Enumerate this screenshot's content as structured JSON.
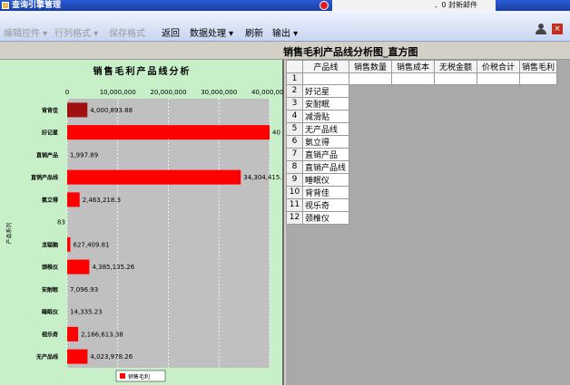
{
  "window": {
    "title": "查询引擎管理",
    "status_text": "．0 封新邮件"
  },
  "toolbar": {
    "items": [
      {
        "label": "编辑控件 ▾",
        "enabled": false
      },
      {
        "label": "行列格式 ▾",
        "enabled": false
      },
      {
        "label": "保存格式",
        "enabled": false
      },
      {
        "label": "返回",
        "enabled": true
      },
      {
        "label": "数据处理 ▾",
        "enabled": true
      },
      {
        "label": "刷新",
        "enabled": true
      },
      {
        "label": "输出 ▾",
        "enabled": true
      }
    ]
  },
  "report": {
    "title": "销售毛利产品线分析图_直方图"
  },
  "chart_data": {
    "type": "bar",
    "orientation": "horizontal",
    "title": "销售毛利产品线分析",
    "ylabel": "产品系列",
    "xlim": [
      0,
      40000000
    ],
    "x_ticks": [
      "0",
      "10,000,000",
      "20,000,000",
      "30,000,000",
      "40,000,000"
    ],
    "categories": [
      "背背佳",
      "好记星",
      "直销产品",
      "直销产品线",
      "氨立得",
      "83",
      "龙聪脑",
      "颈椎仪",
      "安耐眠",
      "睡眠仪",
      "视乐奇",
      "无产品线"
    ],
    "values": [
      4000893.88,
      40000000,
      1997.89,
      34304415,
      2463218.3,
      83,
      627409.81,
      4385135.26,
      7096.93,
      14335.23,
      2166613.38,
      4023978.26
    ],
    "data_labels": [
      "4,000,893.88",
      "40",
      "1,997.89",
      "34,304,415.",
      "2,463,218.3",
      "83",
      "627,409.81",
      "4,385,135.26",
      "7,096.93",
      "14,335.23",
      "2,166,613.38",
      "4,023,978.26"
    ],
    "bar_colors": [
      "#a01010",
      "#ff0000",
      "#ff0000",
      "#ff0000",
      "#ff0000",
      "#ff0000",
      "#ff0000",
      "#ff0000",
      "#ff0000",
      "#ff0000",
      "#ff0000",
      "#ff0000"
    ],
    "series": [
      {
        "name": "销售毛利",
        "color": "#ff0000"
      }
    ],
    "grid": true,
    "legend_position": "bottom-center",
    "plot_background": "#c0c0c0"
  },
  "table": {
    "columns": [
      "产品线",
      "销售数量",
      "销售成本",
      "无税金额",
      "价税合计",
      "销售毛利"
    ],
    "rows": [
      {
        "num": "1",
        "name": ""
      },
      {
        "num": "2",
        "name": "好记星"
      },
      {
        "num": "3",
        "name": "安耐眠"
      },
      {
        "num": "4",
        "name": "减滑贴"
      },
      {
        "num": "5",
        "name": "无产品线"
      },
      {
        "num": "6",
        "name": "氨立得"
      },
      {
        "num": "7",
        "name": "直销产品"
      },
      {
        "num": "8",
        "name": "直销产品线"
      },
      {
        "num": "9",
        "name": "睡眠仪"
      },
      {
        "num": "10",
        "name": "背背佳"
      },
      {
        "num": "11",
        "name": "视乐奇"
      },
      {
        "num": "12",
        "name": "颈椎仪"
      }
    ]
  }
}
